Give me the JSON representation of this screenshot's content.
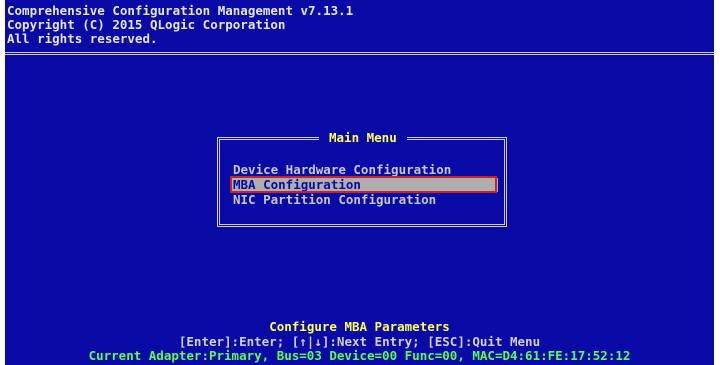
{
  "header": {
    "line1": "Comprehensive Configuration Management v7.13.1",
    "line2": "Copyright (C) 2015 QLogic Corporation",
    "line3": "All rights reserved."
  },
  "main_menu": {
    "title": "Main Menu",
    "items": [
      {
        "label": "Device Hardware Configuration",
        "selected": false
      },
      {
        "label": "MBA Configuration",
        "selected": true
      },
      {
        "label": "NIC Partition Configuration",
        "selected": false
      }
    ]
  },
  "footer": {
    "description": "Configure MBA Parameters",
    "key_help": "[Enter]:Enter; [↑|↓]:Next Entry; [ESC]:Quit Menu",
    "status": "Current Adapter:Primary, Bus=03 Device=00 Func=00, MAC=D4:61:FE:17:52:12"
  },
  "colors": {
    "background": "#0a0aa6",
    "header_text": "#e6e6e6",
    "menu_title": "#ffff55",
    "menu_text": "#c8c8c8",
    "selection_bg": "#aeaeae",
    "highlight_outline": "#cc2222",
    "status_text": "#55ff55"
  }
}
